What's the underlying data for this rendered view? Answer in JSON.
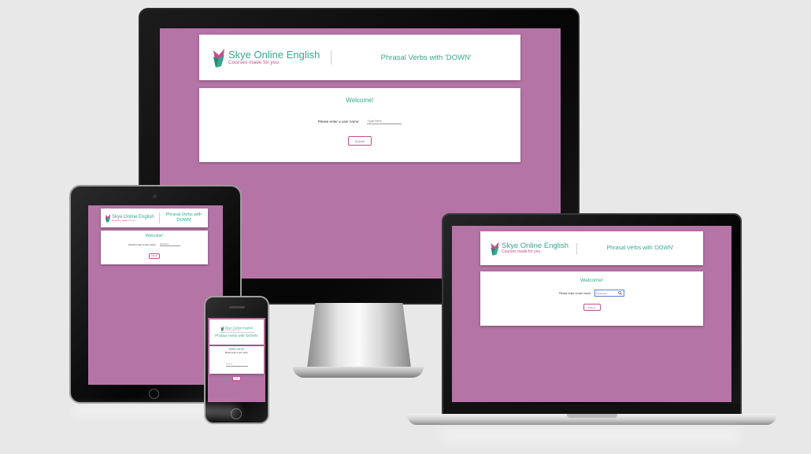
{
  "site": {
    "brand_name": "Skye Online English",
    "tagline": "Courses made for you",
    "header_title": "Phrasal Verbs with 'DOWN'",
    "welcome": "Welcome!",
    "username_label": "Please enter a user name:",
    "submit_label": "Submit"
  },
  "monitor": {
    "username_placeholder": "Type Here"
  },
  "tablet": {
    "username_placeholder": "Typename"
  },
  "phone": {
    "username_placeholder": "typename"
  },
  "laptop": {
    "username_placeholder": "Typename"
  },
  "colors": {
    "page_background": "#b574a6",
    "brand_green": "#35a88e",
    "brand_pink": "#c24f8f",
    "logo_accent_dark": "#1e8a78",
    "logo_accent_light": "#c24f8f"
  },
  "icons": [
    "skye-logo-icon",
    "search-icon"
  ]
}
